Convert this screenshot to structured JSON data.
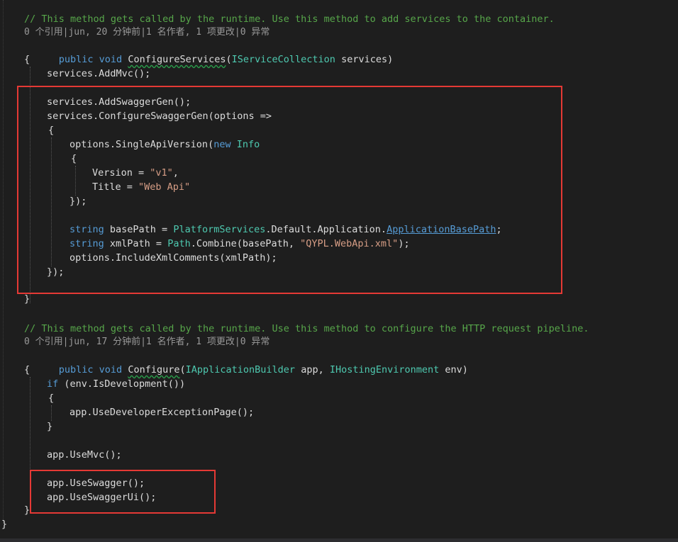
{
  "lines": {
    "l1": {
      "comment": "// This method gets called by the runtime. Use this method to add services to the container."
    },
    "l2": {
      "lens": "0 个引用|jun, 20 分钟前|1 名作者, 1 项更改|0 异常"
    },
    "l3": {
      "kw": "public void",
      "name": "ConfigureServices",
      "open": "(",
      "type": "IServiceCollection",
      "rest": " services)"
    },
    "l4": {
      "text": "{"
    },
    "l5": {
      "text": "services.AddMvc();"
    },
    "l6": {
      "text": "services.AddSwaggerGen();"
    },
    "l7": {
      "text": "services.ConfigureSwaggerGen(options =>"
    },
    "l8": {
      "text": "{"
    },
    "l9": {
      "a": "options.SingleApiVersion(",
      "kw": "new",
      "type": "Info"
    },
    "l10": {
      "text": "{"
    },
    "l11": {
      "a": "Version = ",
      "str": "\"v1\"",
      "b": ","
    },
    "l12": {
      "a": "Title = ",
      "str": "\"Web Api\""
    },
    "l13": {
      "text": "});"
    },
    "l14": {
      "kw": "string",
      "a": " basePath = ",
      "type": "PlatformServices",
      "b": ".Default.Application.",
      "link": "ApplicationBasePath",
      "c": ";"
    },
    "l15": {
      "kw": "string",
      "a": " xmlPath = ",
      "type": "Path",
      "b": ".Combine(basePath, ",
      "str": "\"QYPL.WebApi.xml\"",
      "c": ");"
    },
    "l16": {
      "text": "options.IncludeXmlComments(xmlPath);"
    },
    "l17": {
      "text": "});"
    },
    "l18": {
      "text": "}"
    },
    "l19": {
      "comment": "// This method gets called by the runtime. Use this method to configure the HTTP request pipeline."
    },
    "l20": {
      "lens": "0 个引用|jun, 17 分钟前|1 名作者, 1 项更改|0 异常"
    },
    "l21": {
      "kw": "public void",
      "name": "Configure",
      "open": "(",
      "type1": "IApplicationBuilder",
      "mid": " app, ",
      "type2": "IHostingEnvironment",
      "rest": " env)"
    },
    "l22": {
      "text": "{"
    },
    "l23": {
      "kw": "if",
      "rest": " (env.IsDevelopment())"
    },
    "l24": {
      "text": "{"
    },
    "l25": {
      "text": "app.UseDeveloperExceptionPage();"
    },
    "l26": {
      "text": "}"
    },
    "l27": {
      "text": "app.UseMvc();"
    },
    "l28": {
      "text": "app.UseSwagger();"
    },
    "l29": {
      "text": "app.UseSwaggerUi();"
    },
    "l30": {
      "text": "}"
    },
    "l31": {
      "text": "}"
    }
  },
  "colors": {
    "background": "#1e1e1e",
    "comment": "#57a64a",
    "keyword": "#569cd6",
    "type": "#4ec9b0",
    "string": "#d69d85",
    "highlight_box": "#e53935"
  }
}
